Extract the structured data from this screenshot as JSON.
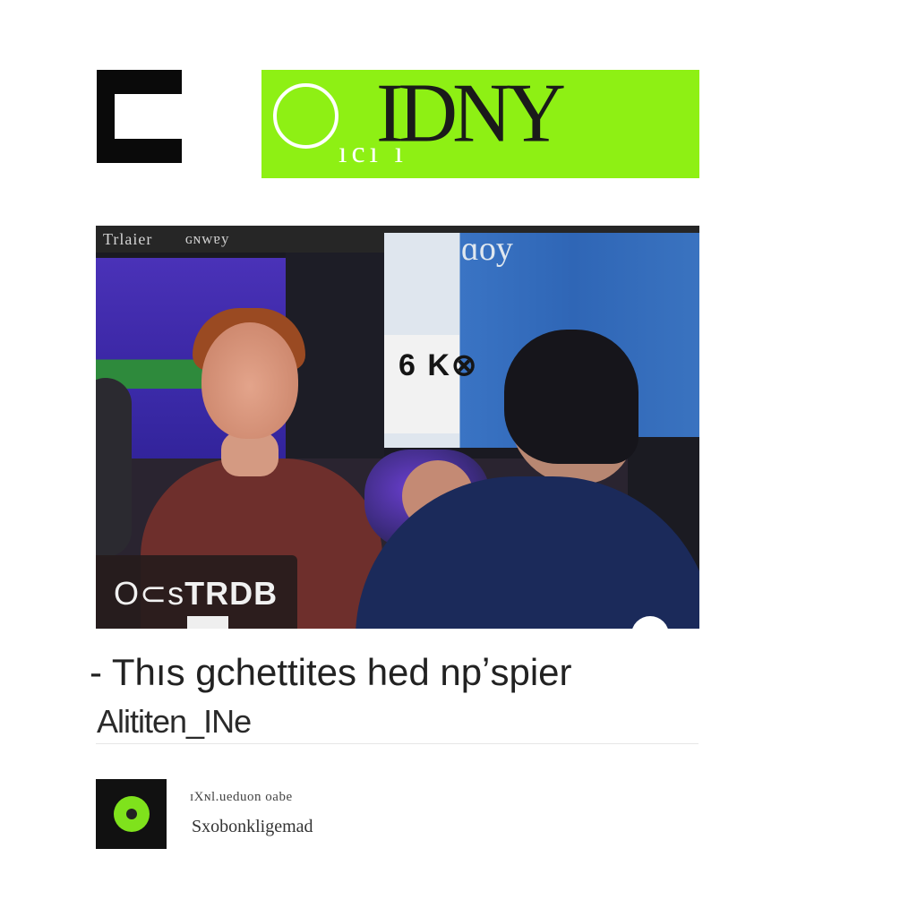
{
  "header": {
    "menu_icon": "menu-icon",
    "brand": {
      "title": "IDNY",
      "subtitle": "ıcı ı",
      "color": "#8ef014",
      "ring_icon": "ring-icon"
    }
  },
  "media": {
    "top_left_caption": "Trlaier",
    "top_caption": "ɢɴwɐy",
    "board_label": "ɑoy",
    "board_card_text": "6 K⊗",
    "badge": {
      "prefix": "O⊂s",
      "strong": "TRDB"
    },
    "play_icon": "play-dot-icon"
  },
  "article": {
    "headline": "- Thıs gchettites hed npʼspier",
    "byline": "Alititen_INe"
  },
  "author": {
    "avatar_icon": "author-avatar-icon",
    "name": "ɪXɴl.ueduon oabe",
    "handle": "Sxobonkligemad"
  }
}
